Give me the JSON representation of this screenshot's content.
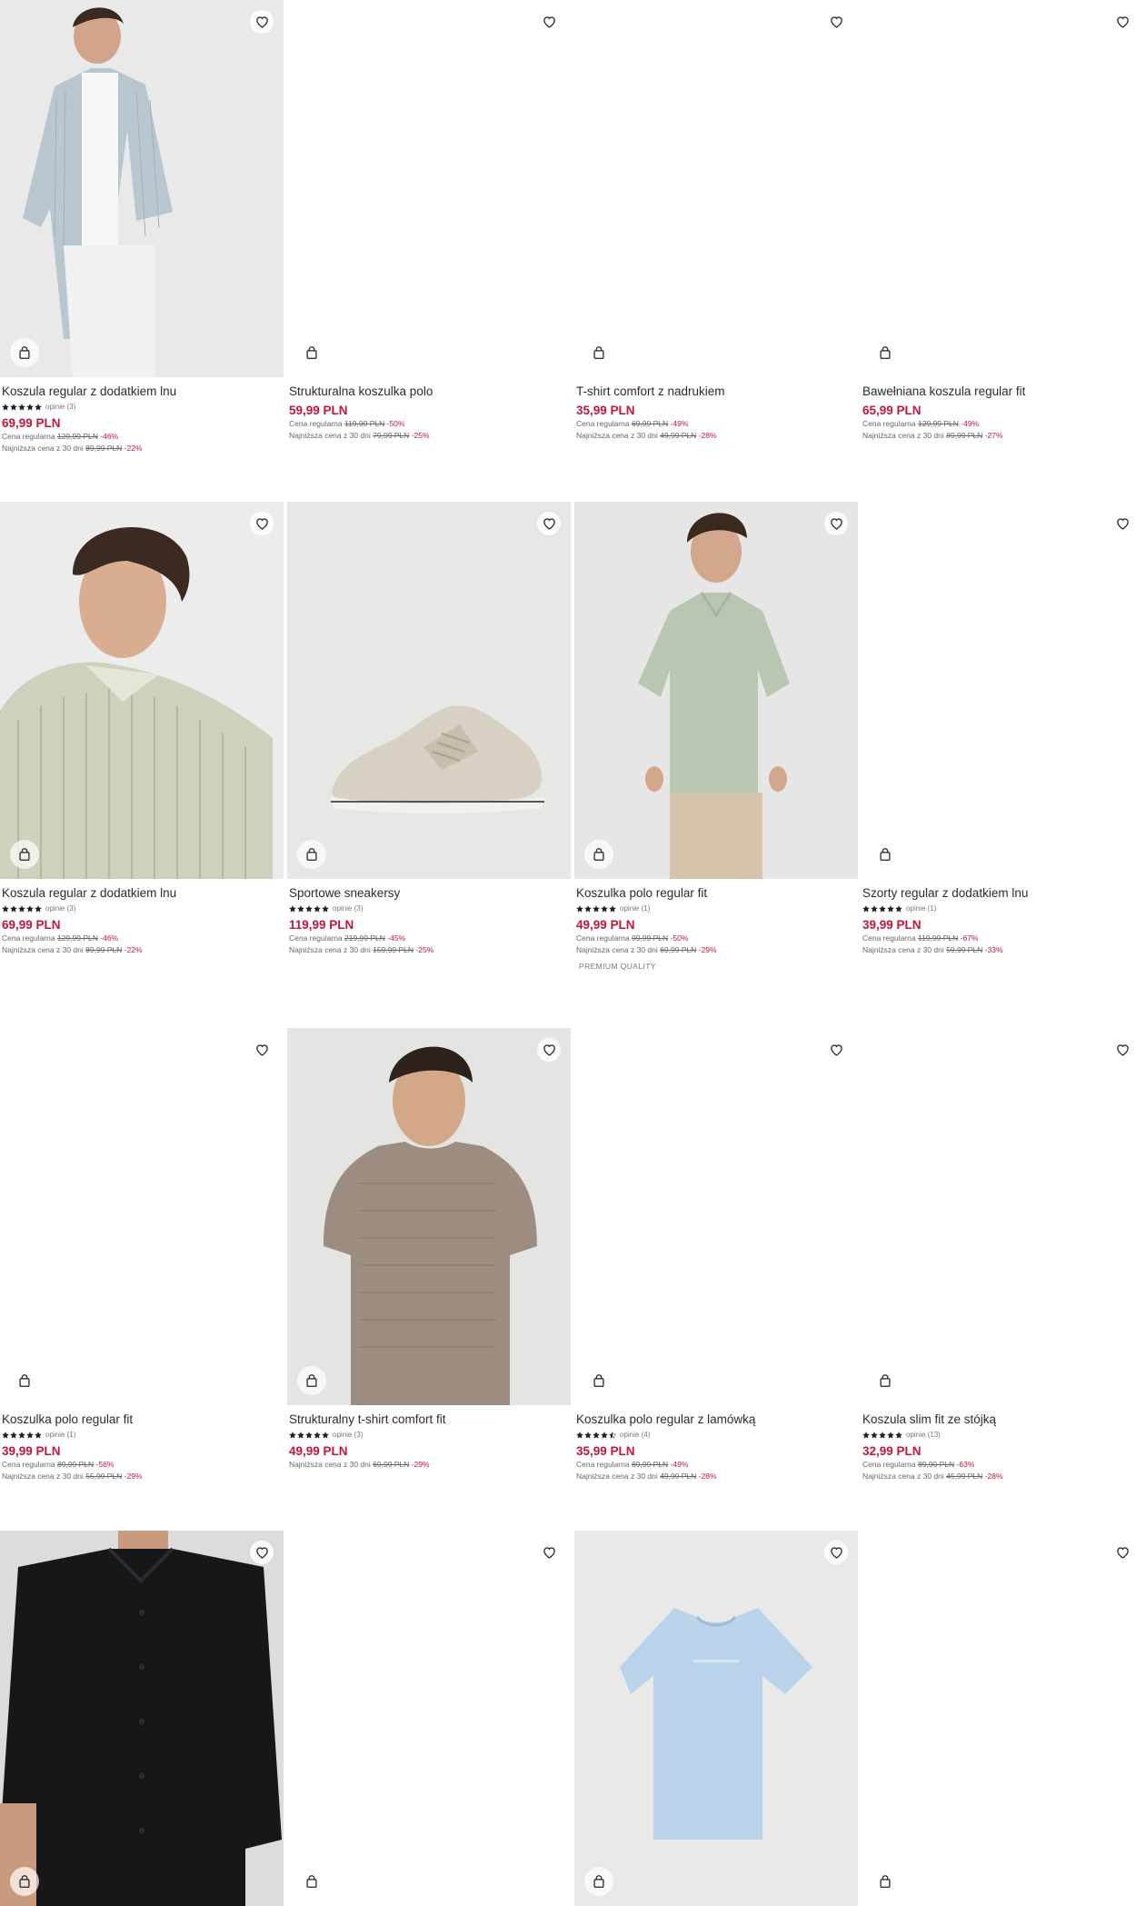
{
  "products": [
    {
      "name": "Koszula regular z dodatkiem lnu",
      "rating": 5,
      "reviews": "opinie (3)",
      "price": "69,99 PLN",
      "regular_label": "Cena regularna",
      "regular_old": "129,99 PLN",
      "regular_disc": "-46%",
      "lowest_label": "Najniższa cena z 30 dni",
      "lowest_old": "89,99 PLN",
      "lowest_disc": "-22%",
      "tag": "",
      "image": "shirt-stripe-blue"
    },
    {
      "name": "Strukturalna koszulka polo",
      "rating": 0,
      "reviews": "",
      "price": "59,99 PLN",
      "regular_label": "Cena regularna",
      "regular_old": "119,99 PLN",
      "regular_disc": "-50%",
      "lowest_label": "Najniższa cena z 30 dni",
      "lowest_old": "79,99 PLN",
      "lowest_disc": "-25%",
      "tag": "",
      "image": "blank"
    },
    {
      "name": "T-shirt comfort z nadrukiem",
      "rating": 0,
      "reviews": "",
      "price": "35,99 PLN",
      "regular_label": "Cena regularna",
      "regular_old": "69,99 PLN",
      "regular_disc": "-49%",
      "lowest_label": "Najniższa cena z 30 dni",
      "lowest_old": "49,99 PLN",
      "lowest_disc": "-28%",
      "tag": "",
      "image": "blank"
    },
    {
      "name": "Bawełniana koszula regular fit",
      "rating": 0,
      "reviews": "",
      "price": "65,99 PLN",
      "regular_label": "Cena regularna",
      "regular_old": "129,99 PLN",
      "regular_disc": "-49%",
      "lowest_label": "Najniższa cena z 30 dni",
      "lowest_old": "89,99 PLN",
      "lowest_disc": "-27%",
      "tag": "",
      "image": "blank"
    },
    {
      "name": "Koszula regular z dodatkiem lnu",
      "rating": 5,
      "reviews": "opinie (3)",
      "price": "69,99 PLN",
      "regular_label": "Cena regularna",
      "regular_old": "129,99 PLN",
      "regular_disc": "-46%",
      "lowest_label": "Najniższa cena z 30 dni",
      "lowest_old": "89,99 PLN",
      "lowest_disc": "-22%",
      "tag": "",
      "image": "shirt-stripe-green"
    },
    {
      "name": "Sportowe sneakersy",
      "rating": 5,
      "reviews": "opinie (3)",
      "price": "119,99 PLN",
      "regular_label": "Cena regularna",
      "regular_old": "219,99 PLN",
      "regular_disc": "-45%",
      "lowest_label": "Najniższa cena z 30 dni",
      "lowest_old": "159,99 PLN",
      "lowest_disc": "-25%",
      "tag": "",
      "image": "sneaker"
    },
    {
      "name": "Koszulka polo regular fit",
      "rating": 5,
      "reviews": "opinie (1)",
      "price": "49,99 PLN",
      "regular_label": "Cena regularna",
      "regular_old": "99,99 PLN",
      "regular_disc": "-50%",
      "lowest_label": "Najniższa cena z 30 dni",
      "lowest_old": "69,99 PLN",
      "lowest_disc": "-29%",
      "tag": "PREMIUM QUALITY",
      "image": "polo-green"
    },
    {
      "name": "Szorty regular z dodatkiem lnu",
      "rating": 5,
      "reviews": "opinie (1)",
      "price": "39,99 PLN",
      "regular_label": "Cena regularna",
      "regular_old": "119,99 PLN",
      "regular_disc": "-67%",
      "lowest_label": "Najniższa cena z 30 dni",
      "lowest_old": "59,99 PLN",
      "lowest_disc": "-33%",
      "tag": "",
      "image": "blank"
    },
    {
      "name": "Koszulka polo regular fit",
      "rating": 5,
      "reviews": "opinie (1)",
      "price": "39,99 PLN",
      "regular_label": "Cena regularna",
      "regular_old": "89,99 PLN",
      "regular_disc": "-56%",
      "lowest_label": "Najniższa cena z 30 dni",
      "lowest_old": "55,99 PLN",
      "lowest_disc": "-29%",
      "tag": "",
      "image": "blank"
    },
    {
      "name": "Strukturalny t-shirt comfort fit",
      "rating": 5,
      "reviews": "opinie (3)",
      "price": "49,99 PLN",
      "regular_label": "",
      "regular_old": "",
      "regular_disc": "",
      "lowest_label": "Najniższa cena z 30 dni",
      "lowest_old": "69,99 PLN",
      "lowest_disc": "-29%",
      "tag": "",
      "image": "tshirt-taupe"
    },
    {
      "name": "Koszulka polo regular z lamówką",
      "rating": 4.5,
      "reviews": "opinie (4)",
      "price": "35,99 PLN",
      "regular_label": "Cena regularna",
      "regular_old": "69,99 PLN",
      "regular_disc": "-49%",
      "lowest_label": "Najniższa cena z 30 dni",
      "lowest_old": "49,99 PLN",
      "lowest_disc": "-28%",
      "tag": "",
      "image": "blank"
    },
    {
      "name": "Koszula slim fit ze stójką",
      "rating": 5,
      "reviews": "opinie (13)",
      "price": "32,99 PLN",
      "regular_label": "Cena regularna",
      "regular_old": "89,99 PLN",
      "regular_disc": "-63%",
      "lowest_label": "Najniższa cena z 30 dni",
      "lowest_old": "45,99 PLN",
      "lowest_disc": "-28%",
      "tag": "",
      "image": "blank"
    },
    {
      "name": "",
      "rating": 0,
      "reviews": "",
      "price": "",
      "regular_label": "",
      "regular_old": "",
      "regular_disc": "",
      "lowest_label": "",
      "lowest_old": "",
      "lowest_disc": "",
      "tag": "",
      "image": "shirt-black"
    },
    {
      "name": "",
      "rating": 0,
      "reviews": "",
      "price": "",
      "regular_label": "",
      "regular_old": "",
      "regular_disc": "",
      "lowest_label": "",
      "lowest_old": "",
      "lowest_disc": "",
      "tag": "",
      "image": "blank"
    },
    {
      "name": "",
      "rating": 0,
      "reviews": "",
      "price": "",
      "regular_label": "",
      "regular_old": "",
      "regular_disc": "",
      "lowest_label": "",
      "lowest_old": "",
      "lowest_disc": "",
      "tag": "",
      "image": "tshirt-blue"
    },
    {
      "name": "",
      "rating": 0,
      "reviews": "",
      "price": "",
      "regular_label": "",
      "regular_old": "",
      "regular_disc": "",
      "lowest_label": "",
      "lowest_old": "",
      "lowest_disc": "",
      "tag": "",
      "image": "blank"
    }
  ],
  "icons": {
    "favorite": "heart-outline-icon",
    "cart": "shopping-bag-icon",
    "star": "star-icon"
  },
  "colors": {
    "price": "#c4163a",
    "discount": "#c4163a",
    "text": "#2b2b2b",
    "muted": "#666666"
  }
}
